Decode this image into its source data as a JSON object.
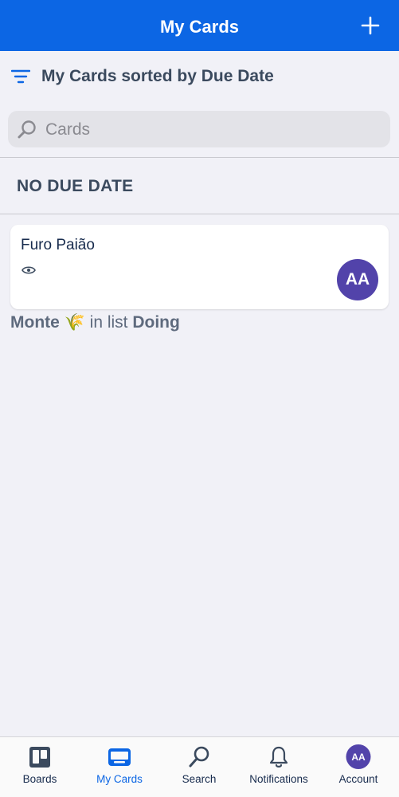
{
  "header": {
    "title": "My Cards"
  },
  "sort": {
    "label": "My Cards sorted by Due Date"
  },
  "search": {
    "placeholder": "Cards"
  },
  "section": {
    "title": "NO DUE DATE"
  },
  "card": {
    "title": "Furo Paião",
    "avatar_initials": "AA",
    "board": "Monte 🌾",
    "list_prefix": "in list",
    "list": "Doing"
  },
  "tabs": [
    {
      "label": "Boards",
      "icon": "boards-icon"
    },
    {
      "label": "My Cards",
      "icon": "cards-icon",
      "active": true
    },
    {
      "label": "Search",
      "icon": "search-icon"
    },
    {
      "label": "Notifications",
      "icon": "bell-icon"
    },
    {
      "label": "Account",
      "icon": "avatar",
      "initials": "AA"
    }
  ],
  "colors": {
    "accent": "#0c66e4",
    "avatar": "#5243aa",
    "background": "#f1f1f7"
  }
}
